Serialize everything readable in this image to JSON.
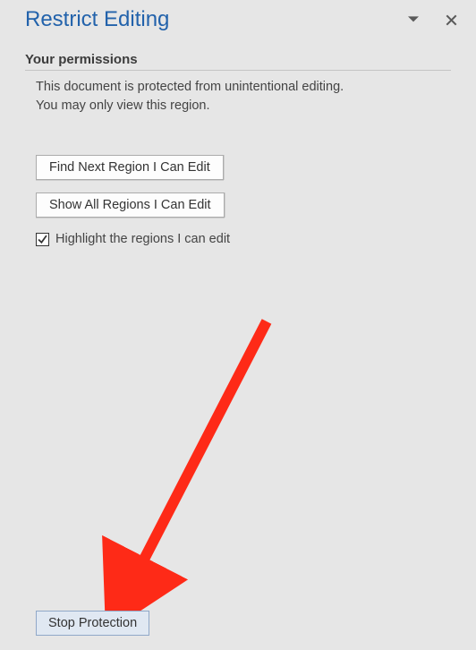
{
  "header": {
    "title": "Restrict Editing"
  },
  "permissions": {
    "section_title": "Your permissions",
    "line1": "This document is protected from unintentional editing.",
    "line2": "You may only view this region."
  },
  "buttons": {
    "find_next": "Find Next Region I Can Edit",
    "show_all": "Show All Regions I Can Edit",
    "stop_protection": "Stop Protection"
  },
  "checkbox": {
    "highlight_label": "Highlight the regions I can edit",
    "checked": true
  },
  "annotation": {
    "arrow_color": "#fe2a17"
  }
}
